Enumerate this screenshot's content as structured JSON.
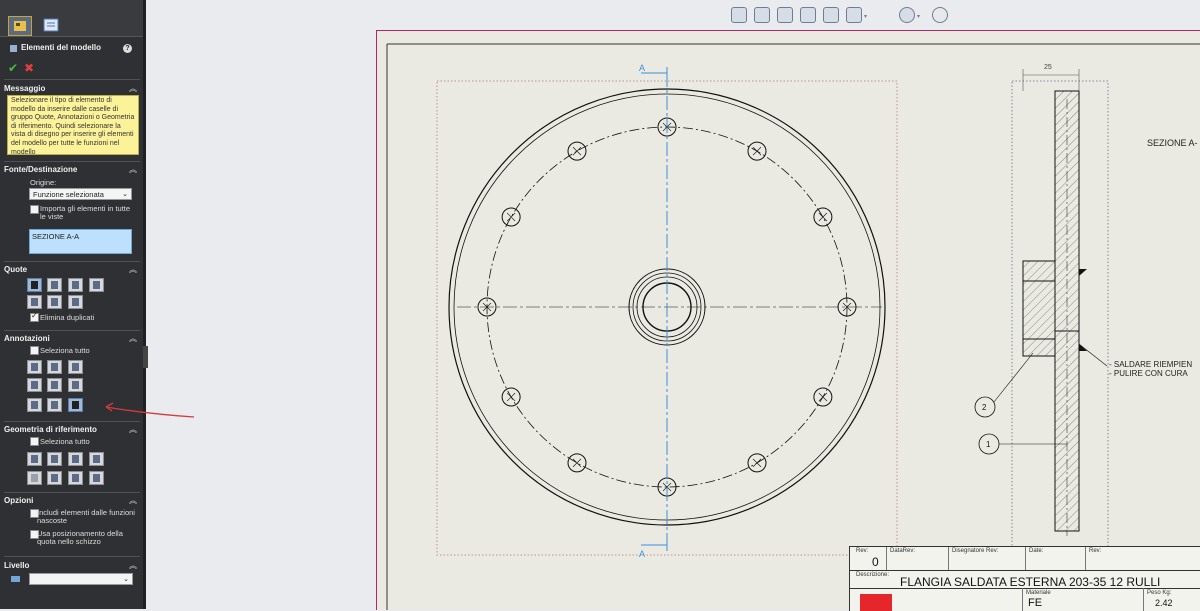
{
  "property_manager": {
    "title": "Elementi del modello",
    "message": {
      "header": "Messaggio",
      "text": "Selezionare il tipo di elemento di modello da inserire dalle caselle di gruppo Quote, Annotazioni o Geometria di riferimento. Quindi selezionare la vista di disegno per inserire gli elementi del modello per tutte le funzioni nel modello"
    },
    "source": {
      "header": "Fonte/Destinazione",
      "origin_label": "Origine:",
      "origin_value": "Funzione selezionata",
      "import_all_label": "Importa gli elementi in tutte le viste",
      "destination_value": "SEZIONE A-A"
    },
    "dimensions": {
      "header": "Quote",
      "eliminate_duplicates": "Elimina duplicati"
    },
    "annotations": {
      "header": "Annotazioni",
      "select_all": "Seleziona tutto"
    },
    "reference_geometry": {
      "header": "Geometria di riferimento",
      "select_all": "Seleziona tutto"
    },
    "options": {
      "header": "Opzioni",
      "include_hidden": "Includi elementi dalle funzioni nascoste",
      "use_sketch_placement": "Usa posizionamento della quota nello schizzo"
    },
    "layer": {
      "header": "Livello",
      "value": ""
    }
  },
  "toolbar": {
    "icons": [
      "zoom-to-fit-icon",
      "zoom-to-area-icon",
      "zoom-in-out-icon",
      "rotate-view-icon",
      "previous-view-icon",
      "display-style-icon",
      "hide-show-icon",
      "appearance-icon"
    ]
  },
  "drawing": {
    "section_marker_top": "A",
    "section_marker_bottom": "A",
    "dimension_25": "25",
    "section_title": "SEZIONE A-",
    "note_line_1": "- SALDARE RIEMPIEN",
    "note_line_2": "- PULIRE CON CURA",
    "balloon_2": "2",
    "balloon_1": "1"
  },
  "title_block": {
    "rev_label": "Rev:",
    "rev_value": "0",
    "data_rev_label": "DataRev:",
    "designer_rev_label": "Disegnatore Rev:",
    "date_label": "Date:",
    "rev2_label": "Rev:",
    "description_label": "Descrizione:",
    "description_value": "FLANGIA SALDATA ESTERNA 203-35 12 RULLI",
    "material_label": "Materiale",
    "material_value": "FE",
    "weight_label": "Peso Kg:",
    "weight_value": "2.42"
  },
  "colors": {
    "panel_bg": "#2f3033",
    "message_bg": "#fbf29a",
    "selection_blue": "#bde0fc",
    "centerline_blue": "#3c8fe0",
    "sheet_border": "#b0266c",
    "annotation_arrow": "#d23c3c",
    "title_block_red": "#e5262b"
  }
}
